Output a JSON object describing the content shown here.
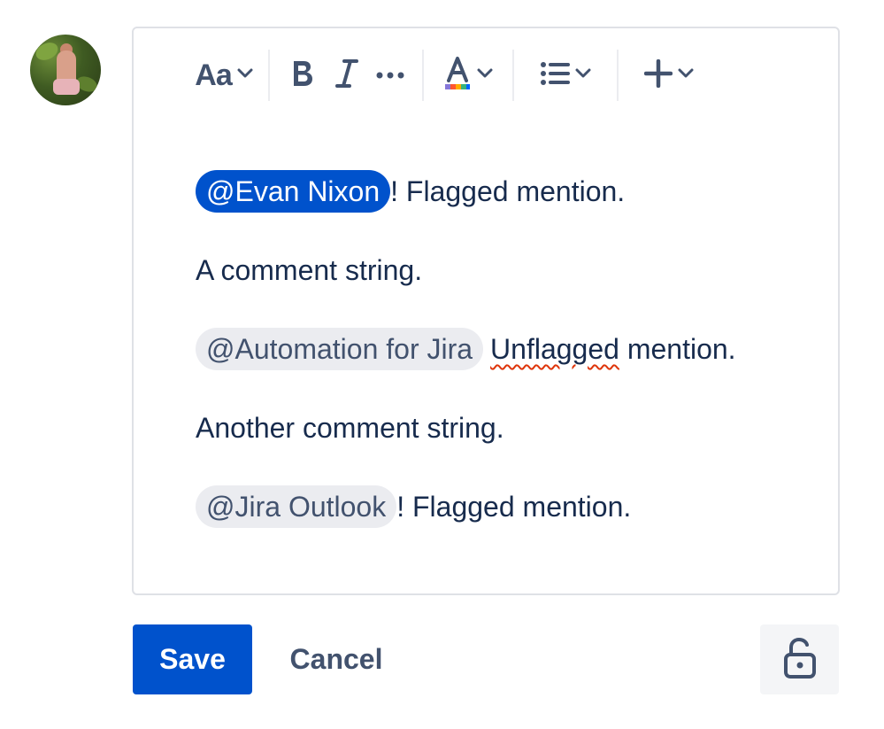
{
  "avatar": {
    "alt": "user-avatar"
  },
  "toolbar": {
    "text_style_label": "Aa",
    "icons": [
      "chevron-down-icon",
      "bold-icon",
      "italic-icon",
      "more-icon",
      "text-color-icon",
      "bullet-list-icon",
      "plus-icon"
    ],
    "text_color_swatch": [
      "#8777d9",
      "#ff5630",
      "#ffab00",
      "#36b37e",
      "#0065ff"
    ]
  },
  "content": {
    "paragraphs": [
      {
        "mention": "@Evan Nixon",
        "mention_style": "flagged",
        "text": " ! Flagged mention."
      },
      {
        "text": "A comment string."
      },
      {
        "mention": "@Automation for Jira",
        "mention_style": "plain",
        "misspelled": "Unflagged",
        "text": " mention."
      },
      {
        "text": "Another comment string."
      },
      {
        "mention": "@Jira Outlook",
        "mention_style": "plain",
        "text": " ! Flagged mention."
      }
    ]
  },
  "actions": {
    "save_label": "Save",
    "cancel_label": "Cancel",
    "restrict_icon": "unlock-icon"
  },
  "colors": {
    "primary": "#0052cc",
    "text": "#172b4d",
    "subtle_text": "#42526e",
    "mention_bg": "#ebecf0",
    "spelling_error": "#de350b"
  }
}
